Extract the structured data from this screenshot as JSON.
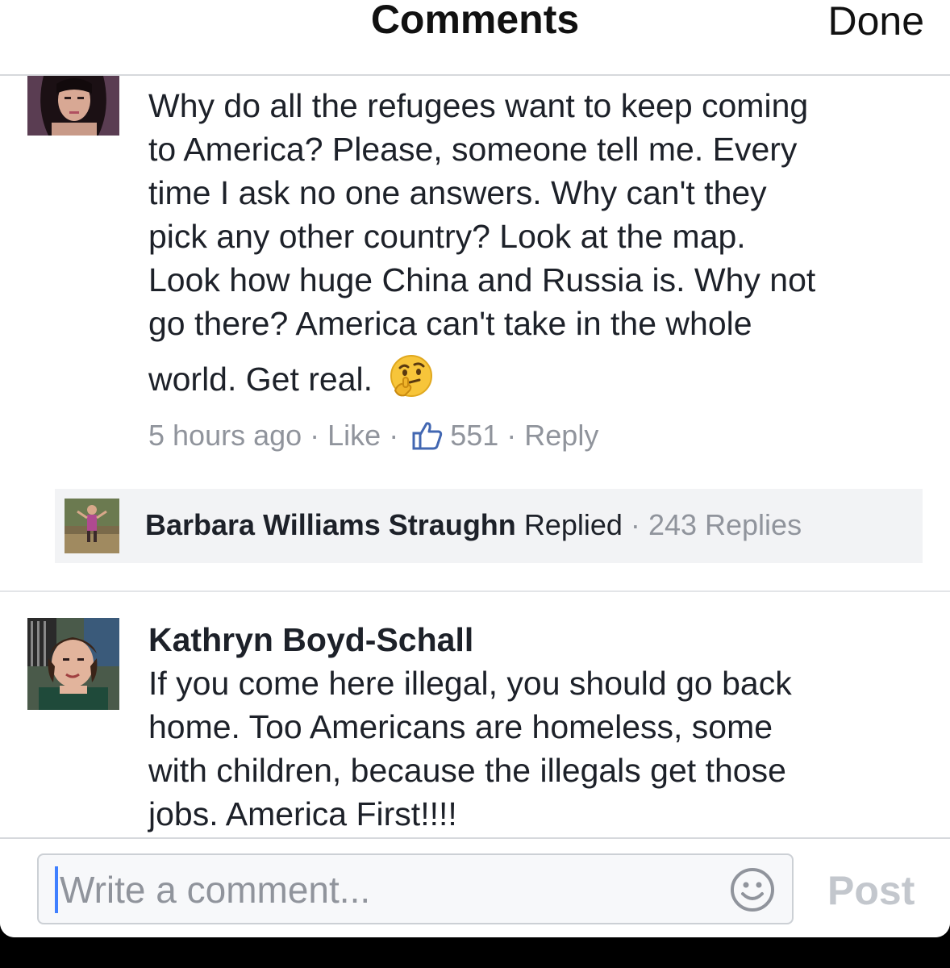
{
  "header": {
    "title": "Comments",
    "done_label": "Done"
  },
  "comments": [
    {
      "text_lines": [
        "Why do all the refugees want to keep coming",
        "to America?  Please, someone tell me.  Every",
        "time I ask no one answers.  Why can't they",
        "pick any other country?  Look at the map.",
        "Look how huge China and Russia is.  Why not",
        "go there?  America can't take in the whole",
        "world.  Get real."
      ],
      "emoji": "thinking-face",
      "time": "5 hours ago",
      "like_label": "Like",
      "like_count": "551",
      "reply_label": "Reply",
      "reply_summary": {
        "name": "Barbara Williams Straughn",
        "action": "Replied",
        "replies": "243 Replies"
      }
    },
    {
      "author": "Kathryn Boyd-Schall",
      "text_lines": [
        "If you come here illegal, you should go back",
        "home.  Too Americans are homeless, some",
        "with children, because the illegals get those",
        "jobs.  America First!!!!"
      ]
    }
  ],
  "composer": {
    "placeholder": "Write a comment...",
    "post_label": "Post"
  },
  "colors": {
    "text": "#1d2129",
    "meta_gray": "#90949c",
    "like_blue": "#4267b2",
    "caret_blue": "#4080ff",
    "reply_bg": "#f2f3f5"
  }
}
